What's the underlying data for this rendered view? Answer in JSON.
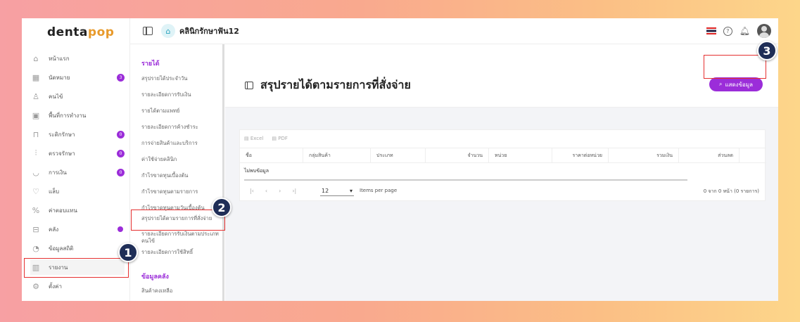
{
  "app": {
    "logo_dark": "denta",
    "logo_accent": "pop",
    "clinic_name": "คลินิกรักษาฟัน12"
  },
  "sidebar": {
    "items": [
      {
        "label": "หน้าแรก",
        "icon": "home-icon"
      },
      {
        "label": "นัดหมาย",
        "icon": "calendar-icon",
        "badge": "3"
      },
      {
        "label": "คนไข้",
        "icon": "user-icon"
      },
      {
        "label": "พื้นที่การทำงาน",
        "icon": "workspace-icon"
      },
      {
        "label": "ระดิกรักษา",
        "icon": "chair-icon",
        "badge": "0"
      },
      {
        "label": "ตรวจรักษา",
        "icon": "tools-icon",
        "badge": "0"
      },
      {
        "label": "การเงิน",
        "icon": "money-icon",
        "badge": "0"
      },
      {
        "label": "แล็บ",
        "icon": "tooth-icon"
      },
      {
        "label": "ค่าตอบแทน",
        "icon": "percent-icon"
      },
      {
        "label": "คลัง",
        "icon": "box-icon",
        "dot": true
      },
      {
        "label": "ข้อมูลสถิติ",
        "icon": "stats-icon"
      },
      {
        "label": "รายงาน",
        "icon": "report-icon"
      },
      {
        "label": "ตั้งค่า",
        "icon": "gear-icon"
      }
    ]
  },
  "submenu": {
    "section_income": "รายได้",
    "items": [
      "สรุปรายได้ประจำวัน",
      "รายละเอียดการรับเงิน",
      "รายได้ตามแพทย์",
      "รายละเอียดการค้างชำระ",
      "การจ่ายสินค้าและบริการ",
      "ค่าใช้จ่ายคลินิก",
      "กำไรขาดทุนเบื้องต้น",
      "กำไรขาดทุนตามรายการ",
      "กำไรขาดทุนตามวันเบื้องต้น",
      "สรุปรายได้ตามรายการที่สั่งจ่าย",
      "รายละเอียดการรับเงินตามประเภทคนไข้",
      "รายละเอียดการใช้สิทธิ์"
    ],
    "section_warehouse": "ข้อมูลคลัง",
    "warehouse_items": [
      "สินค้าคงเหลือ"
    ]
  },
  "main": {
    "title": "สรุปรายได้ตามรายการที่สั่งจ่าย",
    "show_button": "แสดงข้อมูล",
    "export_excel": "Excel",
    "export_pdf": "PDF",
    "columns": [
      "ชื่อ",
      "กลุ่มสินค้า",
      "ประเภท",
      "จำนวน",
      "หน่วย",
      "ราคาต่อหน่วย",
      "รวมเงิน",
      "ส่วนลด"
    ],
    "no_data": "ไม่พบข้อมูล",
    "per_page_value": "12",
    "per_page_label": "Items per page",
    "count_text": "0 จาก 0 หน้า (0 รายการ)"
  },
  "annotations": [
    "1",
    "2",
    "3"
  ],
  "colors": {
    "accent": "#9b2dd9",
    "highlight": "#e53030",
    "marker": "#1f2e57"
  }
}
